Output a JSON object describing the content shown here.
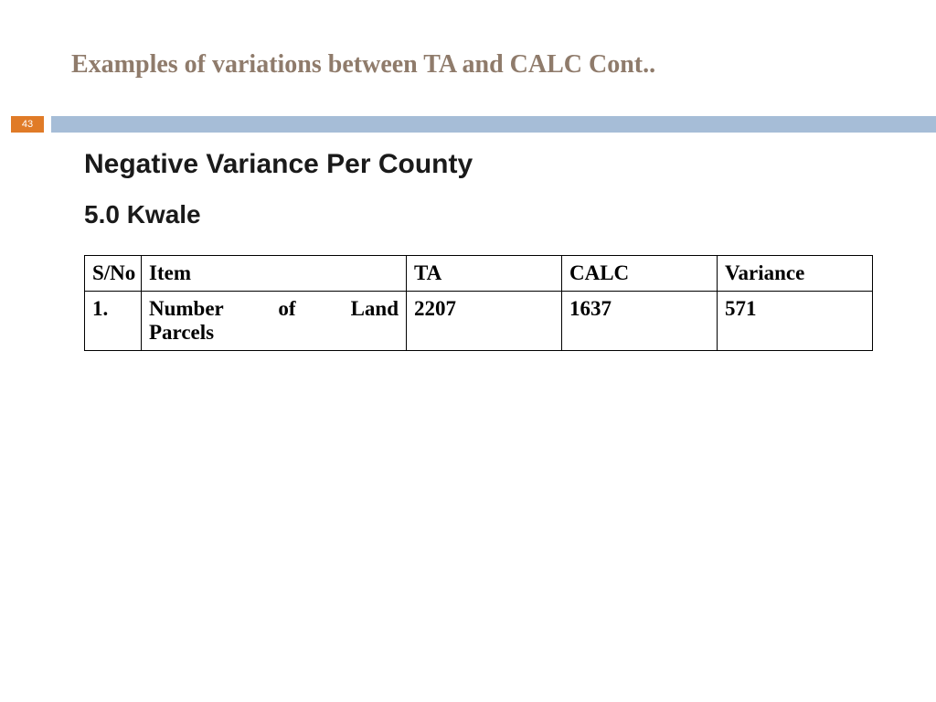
{
  "slide_number": "43",
  "title": "Examples of variations between TA and CALC Cont..",
  "subtitle": "Negative Variance Per County",
  "section": "5.0 Kwale",
  "table": {
    "headers": {
      "sn": "S/No",
      "item": "Item",
      "ta": "TA",
      "calc": "CALC",
      "variance": "Variance"
    },
    "rows": [
      {
        "sn": "1.",
        "item_line1": "Number of Land",
        "item_line2": "Parcels",
        "ta": "2207",
        "calc": "1637",
        "variance": "571"
      }
    ]
  }
}
